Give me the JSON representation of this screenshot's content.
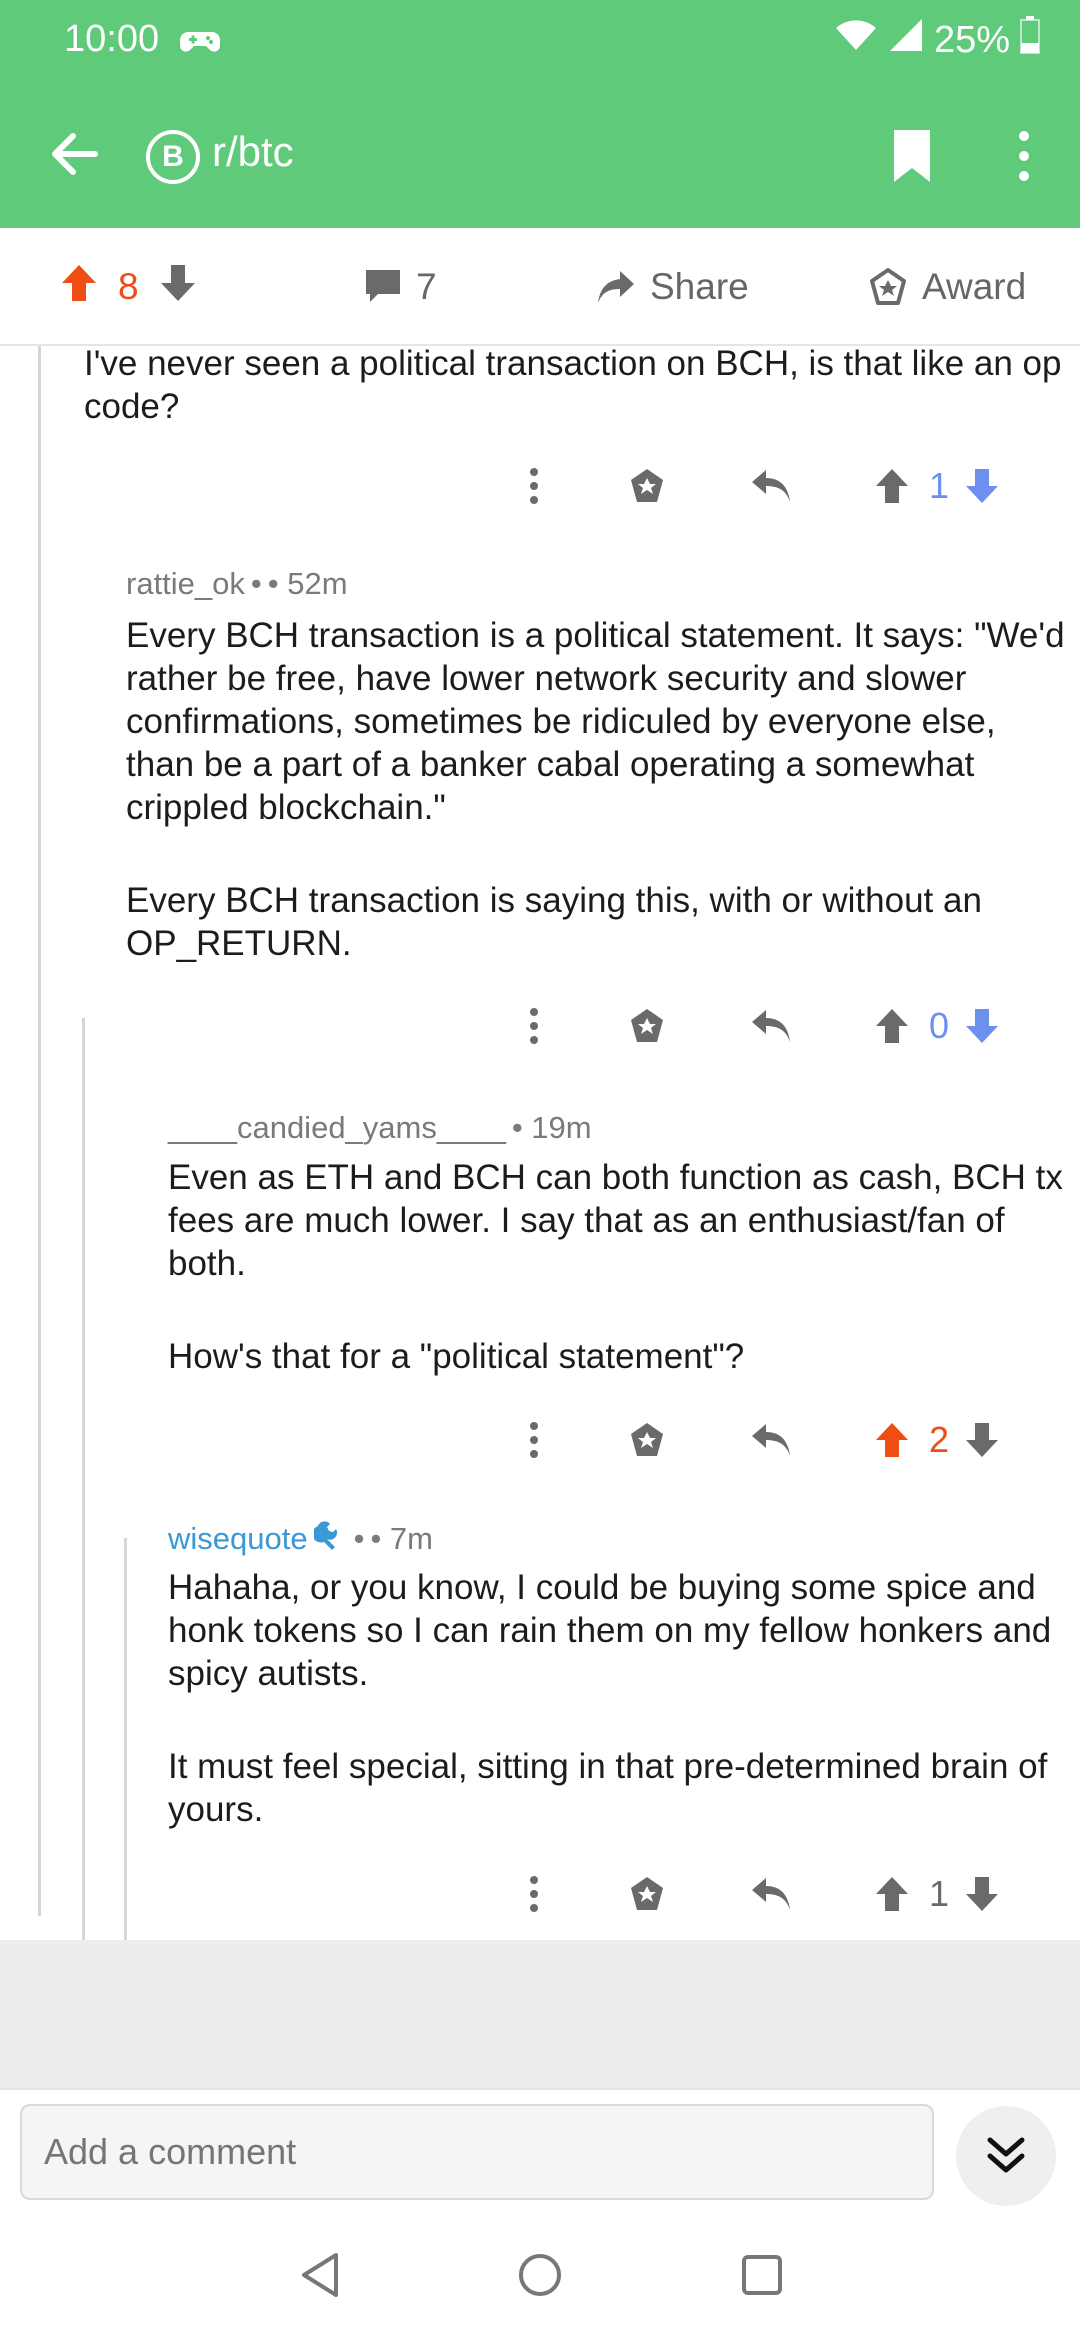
{
  "status_bar": {
    "time": "10:00",
    "battery": "25%"
  },
  "header": {
    "subreddit": "r/btc",
    "subreddit_badge": "B"
  },
  "post_actions": {
    "score": "8",
    "comments": "7",
    "share_label": "Share",
    "award_label": "Award"
  },
  "comments": [
    {
      "paragraphs": [
        "I've never seen a political transaction on BCH, is that like an op code?"
      ],
      "score": "1",
      "vote_state": "none"
    },
    {
      "author": "rattie_ok",
      "author_sep": "•",
      "age": "• 52m",
      "paragraphs": [
        "Every BCH transaction is a political statement. It says: \"We'd rather be free, have lower network security and slower confirmations, sometimes be ridiculed by everyone else, than be a part of a banker cabal operating a somewhat crippled blockchain.\"",
        "Every BCH transaction is saying this, with or without an OP_RETURN."
      ],
      "score": "0",
      "vote_state": "none"
    },
    {
      "author": "____candied_yams____",
      "age": "• 19m",
      "paragraphs": [
        "Even as ETH and BCH can both function as cash, BCH tx fees are much lower. I say that as an enthusiast/fan of both.",
        "How's that for a \"political statement\"?"
      ],
      "score": "2",
      "vote_state": "up"
    },
    {
      "author": "wisequote",
      "author_sep": "•",
      "age": "• 7m",
      "paragraphs": [
        "Hahaha, or you know, I could be buying some spice and honk tokens so I can rain them on my fellow honkers and spicy autists.",
        "It must feel special, sitting in that pre-determined brain of yours."
      ],
      "score": "1",
      "vote_state": "none"
    }
  ],
  "composer": {
    "placeholder": "Add a comment"
  },
  "colors": {
    "header_green": "#5fca7a",
    "upvote_orange": "#ee4d14",
    "vote_blue": "#6d8ff0",
    "username_blue": "#3b98d6"
  }
}
